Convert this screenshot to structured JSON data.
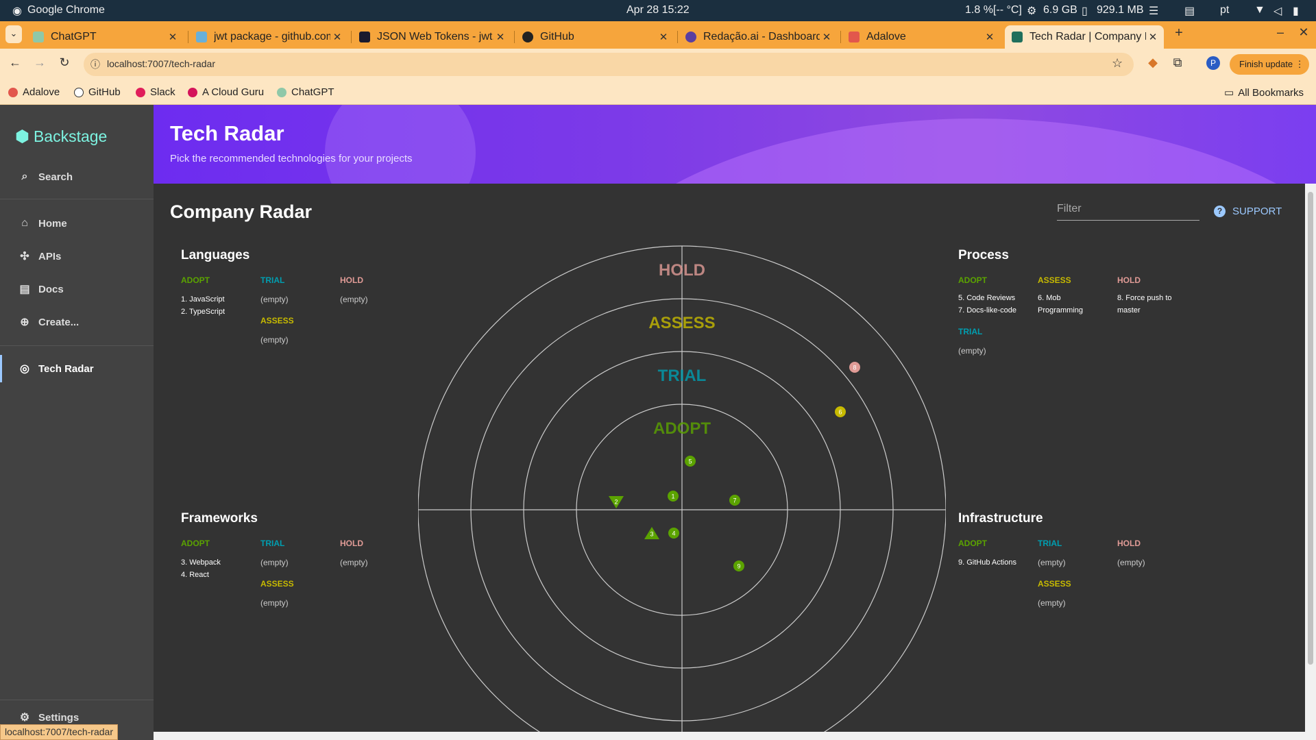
{
  "os": {
    "app_name": "Google Chrome",
    "datetime": "Apr 28  15:22",
    "cpu": "1.8 %[-- °C]",
    "mem": "6.9 GB",
    "swap": "929.1 MB",
    "lang": "pt"
  },
  "tabs": [
    {
      "label": "ChatGPT",
      "active": false
    },
    {
      "label": "jwt package - github.com",
      "active": false
    },
    {
      "label": "JSON Web Tokens - jwt.io",
      "active": false
    },
    {
      "label": "GitHub",
      "active": false
    },
    {
      "label": "Redação.ai - Dashboard",
      "active": false
    },
    {
      "label": "Adalove",
      "active": false
    },
    {
      "label": "Tech Radar | Company Radar",
      "active": true
    }
  ],
  "toolbar": {
    "url": "localhost:7007/tech-radar",
    "finish_update": "Finish update",
    "profile_initial": "P"
  },
  "bookmarks": [
    "Adalove",
    "GitHub",
    "Slack",
    "A Cloud Guru",
    "ChatGPT"
  ],
  "all_bookmarks": "All Bookmarks",
  "sidebar": {
    "brand": "Backstage",
    "search": "Search",
    "items": [
      "Home",
      "APIs",
      "Docs",
      "Create...",
      "Tech Radar",
      "Settings"
    ]
  },
  "header": {
    "title": "Tech Radar",
    "subtitle": "Pick the recommended technologies for your projects"
  },
  "page": {
    "title": "Company Radar",
    "filter_placeholder": "Filter",
    "support": "SUPPORT"
  },
  "rings": {
    "adopt": "ADOPT",
    "trial": "TRIAL",
    "assess": "ASSESS",
    "hold": "HOLD"
  },
  "ring_labels_radar": {
    "hold": "HOLD",
    "assess": "ASSESS",
    "trial": "TRIAL",
    "adopt": "ADOPT"
  },
  "empty_text": "(empty)",
  "quadrants": {
    "languages": {
      "title": "Languages",
      "adopt": [
        "1. JavaScript",
        "2. TypeScript"
      ]
    },
    "process": {
      "title": "Process",
      "adopt": [
        "5. Code Reviews",
        "7. Docs-like-code"
      ],
      "assess": [
        "6. Mob Programming"
      ],
      "hold": [
        "8. Force push to master"
      ]
    },
    "frameworks": {
      "title": "Frameworks",
      "adopt": [
        "3. Webpack",
        "4. React"
      ]
    },
    "infrastructure": {
      "title": "Infrastructure",
      "adopt": [
        "9. GitHub Actions"
      ]
    }
  },
  "blips": [
    {
      "id": "1",
      "shape": "circle",
      "ring": "adopt",
      "color": "#5ba300"
    },
    {
      "id": "2",
      "shape": "triangle-down",
      "ring": "adopt",
      "color": "#5ba300"
    },
    {
      "id": "3",
      "shape": "triangle-up",
      "ring": "adopt",
      "color": "#5ba300"
    },
    {
      "id": "4",
      "shape": "circle",
      "ring": "adopt",
      "color": "#5ba300"
    },
    {
      "id": "5",
      "shape": "circle",
      "ring": "adopt",
      "color": "#5ba300"
    },
    {
      "id": "6",
      "shape": "circle",
      "ring": "assess",
      "color": "#c7ba00"
    },
    {
      "id": "7",
      "shape": "circle",
      "ring": "adopt",
      "color": "#5ba300"
    },
    {
      "id": "8",
      "shape": "circle",
      "ring": "hold",
      "color": "#e09b96"
    },
    {
      "id": "9",
      "shape": "circle",
      "ring": "adopt",
      "color": "#5ba300"
    }
  ],
  "status_url": "localhost:7007/tech-radar",
  "colors": {
    "adopt": "#5ba300",
    "trial": "#009eb0",
    "assess": "#c7ba00",
    "hold": "#e09b96",
    "banner": "#7c3ae8",
    "accent": "#9cc9ff"
  }
}
